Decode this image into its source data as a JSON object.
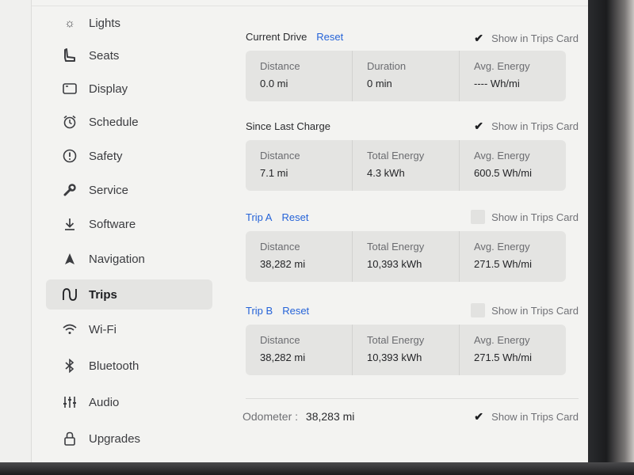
{
  "sidebar": {
    "items": [
      {
        "label": "Lights",
        "icon": "sun-icon"
      },
      {
        "label": "Seats",
        "icon": "seat-icon"
      },
      {
        "label": "Display",
        "icon": "display-icon"
      },
      {
        "label": "Schedule",
        "icon": "alarm-icon"
      },
      {
        "label": "Safety",
        "icon": "alert-circle-icon"
      },
      {
        "label": "Service",
        "icon": "wrench-icon"
      },
      {
        "label": "Software",
        "icon": "download-icon"
      },
      {
        "label": "Navigation",
        "icon": "navigation-arrow-icon"
      },
      {
        "label": "Trips",
        "icon": "trips-icon",
        "active": true
      },
      {
        "label": "Wi-Fi",
        "icon": "wifi-icon"
      },
      {
        "label": "Bluetooth",
        "icon": "bluetooth-icon"
      },
      {
        "label": "Audio",
        "icon": "equalizer-icon"
      },
      {
        "label": "Upgrades",
        "icon": "lock-icon"
      }
    ]
  },
  "trips": {
    "show_in_card_label": "Show in Trips Card",
    "current_drive": {
      "title": "Current Drive",
      "reset": "Reset",
      "show_checked": true,
      "stats": [
        {
          "label": "Distance",
          "value": "0.0 mi"
        },
        {
          "label": "Duration",
          "value": "0 min"
        },
        {
          "label": "Avg. Energy",
          "value": "---- Wh/mi"
        }
      ]
    },
    "since_last_charge": {
      "title": "Since Last Charge",
      "show_checked": true,
      "stats": [
        {
          "label": "Distance",
          "value": "7.1 mi"
        },
        {
          "label": "Total Energy",
          "value": "4.3 kWh"
        },
        {
          "label": "Avg. Energy",
          "value": "600.5 Wh/mi"
        }
      ]
    },
    "trip_a": {
      "title": "Trip A",
      "reset": "Reset",
      "show_checked": false,
      "stats": [
        {
          "label": "Distance",
          "value": "38,282 mi"
        },
        {
          "label": "Total Energy",
          "value": "10,393 kWh"
        },
        {
          "label": "Avg. Energy",
          "value": "271.5 Wh/mi"
        }
      ]
    },
    "trip_b": {
      "title": "Trip B",
      "reset": "Reset",
      "show_checked": false,
      "stats": [
        {
          "label": "Distance",
          "value": "38,282 mi"
        },
        {
          "label": "Total Energy",
          "value": "10,393 kWh"
        },
        {
          "label": "Avg. Energy",
          "value": "271.5 Wh/mi"
        }
      ]
    },
    "odometer": {
      "label": "Odometer :",
      "value": "38,283 mi",
      "show_checked": true
    }
  },
  "colors": {
    "accent": "#2563d8",
    "screen_bg": "#f3f3f1",
    "card_bg": "#e4e4e2"
  }
}
